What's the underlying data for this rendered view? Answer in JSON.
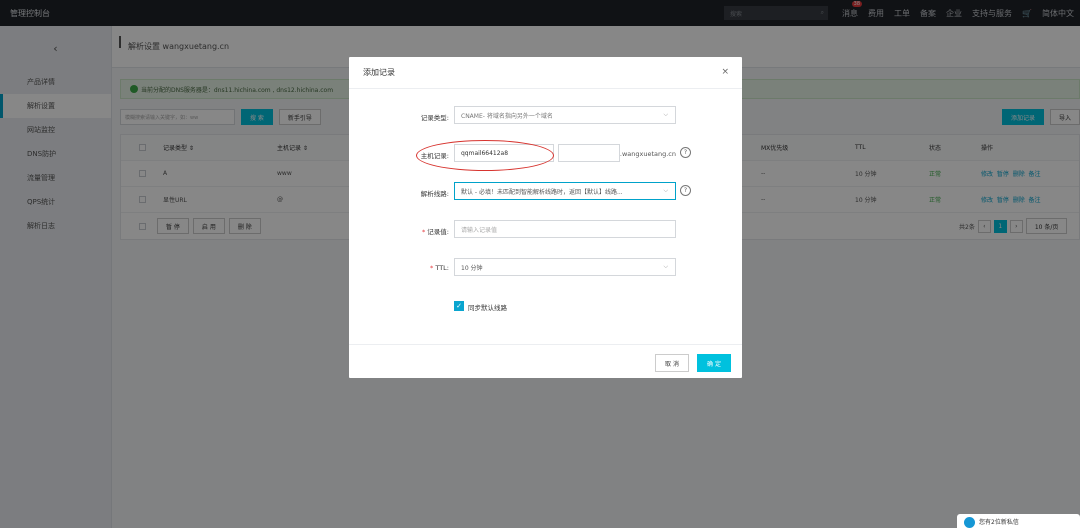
{
  "topbar": {
    "brand": "管理控制台",
    "search_placeholder": "搜索",
    "items": [
      "消息",
      "费用",
      "工单",
      "备案",
      "企业",
      "支持与服务",
      "简体中文"
    ],
    "message_count": "38"
  },
  "sidebar": {
    "back": "‹",
    "items": [
      {
        "label": "产品详情"
      },
      {
        "label": "解析设置"
      },
      {
        "label": "网站监控"
      },
      {
        "label": "DNS防护"
      },
      {
        "label": "流量管理"
      },
      {
        "label": "QPS统计"
      },
      {
        "label": "解析日志"
      }
    ]
  },
  "main": {
    "title": "解析设置 wangxuetang.cn",
    "notice": "当前分配的DNS服务器是：dns11.hichina.com , dns12.hichina.com",
    "toolbar": {
      "search_placeholder": "模糊搜索请输入关键字，如：ww",
      "search": "搜 索",
      "guide": "新手引导",
      "add_record": "添加记录",
      "import": "导入"
    },
    "table": {
      "headers": [
        "记录类型 ⇕",
        "主机记录 ⇕",
        "MX优先级",
        "TTL",
        "状态",
        "操作"
      ],
      "rows": [
        {
          "type": "A",
          "host": "www",
          "mx": "--",
          "ttl": "10 分钟",
          "status": "正常",
          "ops": [
            "修改",
            "暂停",
            "删除",
            "备注"
          ]
        },
        {
          "type": "显性URL",
          "host": "@",
          "mx": "--",
          "ttl": "10 分钟",
          "status": "正常",
          "ops": [
            "修改",
            "暂停",
            "删除",
            "备注"
          ]
        }
      ],
      "batch": [
        "暂 停",
        "启 用",
        "删 除"
      ],
      "pager": {
        "total": "共2条",
        "current": "1",
        "page_size": "10 条/页"
      }
    },
    "colors": {
      "accent": "#00c1de",
      "ok": "#3dab48"
    }
  },
  "modal": {
    "title": "添加记录",
    "close": "×",
    "fields": {
      "type_label": "记录类型:",
      "type_value": "CNAME- 将域名指向另外一个域名",
      "host_label": "主机记录:",
      "host_value": "qqmail66412a8",
      "host_suffix": ".wangxuetang.cn",
      "line_label": "解析线路:",
      "line_value": "默认 - 必填！未匹配到智能解析线路时，返回【默认】线路...",
      "value_label": "记录值:",
      "value_placeholder": "请输入记录值",
      "ttl_label": "TTL:",
      "ttl_value": "10 分钟",
      "sync_label": "同步默认线路",
      "required": "*"
    },
    "cancel": "取 消",
    "confirm": "确 定"
  },
  "chat": {
    "text": "您有2位新私信"
  }
}
